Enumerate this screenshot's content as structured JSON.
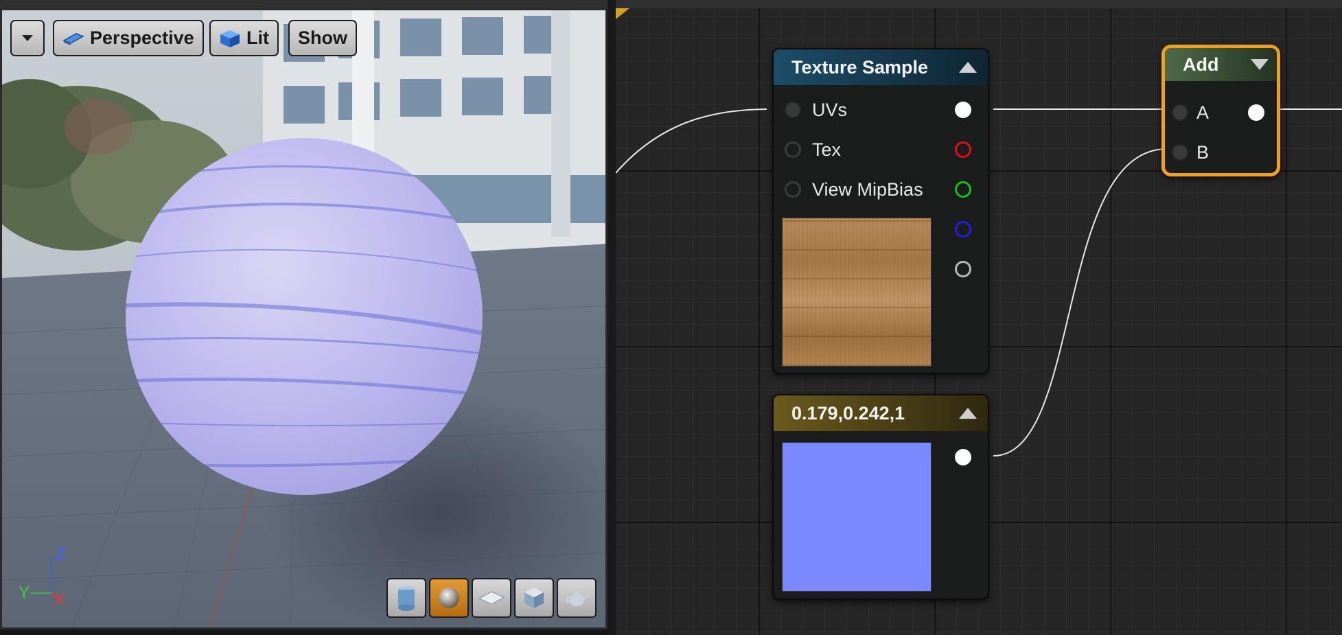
{
  "viewport": {
    "menu_label": "",
    "view_mode": "Perspective",
    "lighting_mode": "Lit",
    "show_label": "Show",
    "axis": {
      "z": "Z",
      "y": "Y",
      "x": "X"
    },
    "preview_shapes": [
      "cylinder-icon",
      "sphere-icon",
      "plane-icon",
      "cube-icon",
      "teapot-icon"
    ],
    "active_shape": "sphere-icon"
  },
  "nodes": {
    "texture_sample": {
      "title": "Texture Sample",
      "header_color": "#1c4d68",
      "inputs": [
        "UVs",
        "Tex",
        "View MipBias"
      ],
      "output_pin_colors": [
        "#ffffff",
        "#e01010",
        "#18c018",
        "#2020e0",
        "#b8b8b8"
      ],
      "preview": "wood-texture"
    },
    "constant": {
      "title": "0.179,0.242,1",
      "header_color": "#6b5a1c",
      "color_value": "#7a89ff"
    },
    "add": {
      "title": "Add",
      "header_color": "#4d6a47",
      "selected_border": "#f0a020",
      "inputs": [
        "A",
        "B"
      ]
    }
  }
}
